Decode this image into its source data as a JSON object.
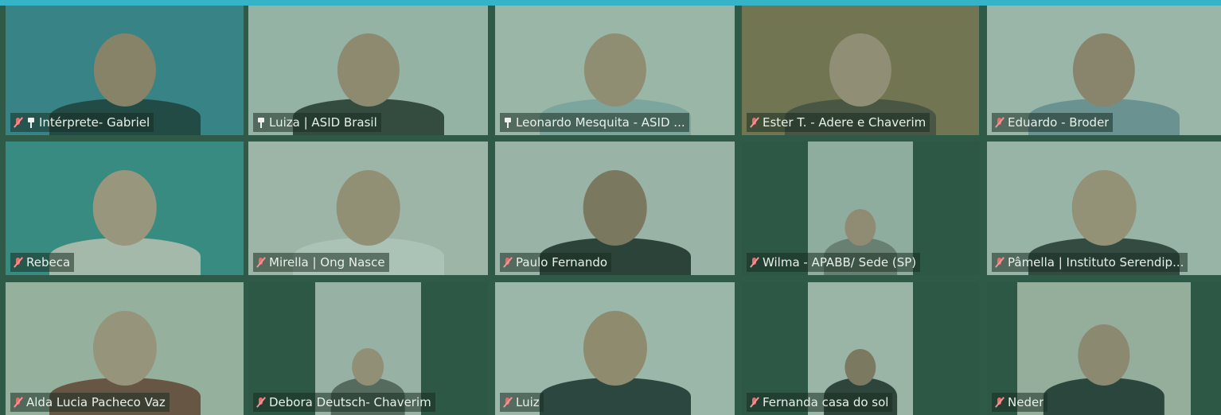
{
  "meeting": {
    "participants": [
      {
        "name": "Intérprete- Gabriel",
        "muted": true,
        "pinned": true,
        "bg": "#3f8fa3",
        "skin": "#b98f77",
        "shirt": "#1f3a40",
        "active": false
      },
      {
        "name": "Luiza | ASID Brasil",
        "muted": false,
        "pinned": true,
        "bg": "#cfd9d1",
        "skin": "#c39a80",
        "shirt": "#3b3b36",
        "active": true
      },
      {
        "name": "Leonardo Mesquita - ASID ...",
        "muted": false,
        "pinned": true,
        "bg": "#d7ddd6",
        "skin": "#c69f85",
        "shirt": "#a9c4c8",
        "active": false
      },
      {
        "name": "Ester T. - Adere e Chaverim",
        "muted": true,
        "pinned": false,
        "bg": "#9a7a52",
        "skin": "#c8a088",
        "shirt": "#5a4b3c",
        "active": false
      },
      {
        "name": "Eduardo - Broder",
        "muted": true,
        "pinned": false,
        "bg": "#d8ddd8",
        "skin": "#bc937b",
        "shirt": "#8ca6b4",
        "active": false
      },
      {
        "name": "Rebeca",
        "muted": true,
        "pinned": false,
        "bg": "#3f9b9b",
        "skin": "#d4ac95",
        "shirt": "#e7e2da",
        "active": false
      },
      {
        "name": "Mirella | Ong Nasce",
        "muted": true,
        "pinned": false,
        "bg": "#dadcd6",
        "skin": "#caa488",
        "shirt": "#f2f2ee",
        "active": false
      },
      {
        "name": "Paulo Fernando",
        "muted": true,
        "pinned": false,
        "bg": "#d6d9d4",
        "skin": "#a77f67",
        "shirt": "#2d2d2d",
        "active": false
      },
      {
        "name": "Wilma - APABB/ Sede (SP)",
        "muted": true,
        "pinned": false,
        "bg": "#c7cfc9",
        "skin": "#c69d86",
        "shirt": "#8a8a84",
        "active": false
      },
      {
        "name": "Pâmella | Instituto Serendip...",
        "muted": true,
        "pinned": false,
        "bg": "#d3dbd5",
        "skin": "#cda58b",
        "shirt": "#3a3a38",
        "active": false
      },
      {
        "name": "Alda Lucia Pacheco Vaz",
        "muted": true,
        "pinned": false,
        "bg": "#cfd6c7",
        "skin": "#d2ab92",
        "shirt": "#8b4b40",
        "active": false
      },
      {
        "name": "Debora Deutsch- Chaverim",
        "muted": true,
        "pinned": false,
        "bg": "#d3d7d1",
        "skin": "#c9a28a",
        "shirt": "#6d6a66",
        "active": false
      },
      {
        "name": "Luiz",
        "muted": true,
        "pinned": false,
        "bg": "#d9dfd9",
        "skin": "#c59b80",
        "shirt": "#2e3437",
        "active": false
      },
      {
        "name": "Fernanda casa do sol",
        "muted": true,
        "pinned": false,
        "bg": "#d7dbd5",
        "skin": "#a9806a",
        "shirt": "#303030",
        "active": false
      },
      {
        "name": "Neder",
        "muted": true,
        "pinned": false,
        "bg": "#cfcfc3",
        "skin": "#c09a82",
        "shirt": "#2d3434",
        "active": false
      }
    ]
  },
  "colors": {
    "accent_bar": "#35b4c8",
    "grid_bg": "#2f5a48",
    "active_border": "#8fd08a"
  }
}
